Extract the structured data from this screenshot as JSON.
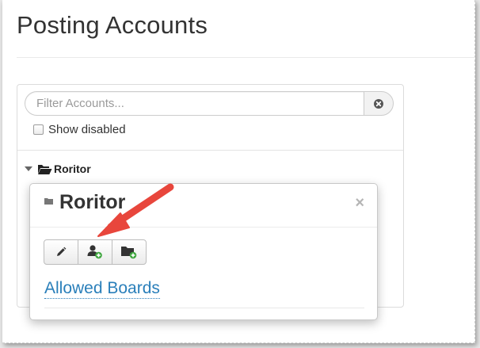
{
  "page": {
    "title": "Posting Accounts"
  },
  "filter": {
    "placeholder": "Filter Accounts...",
    "value": "",
    "clear_icon": "times-circle-icon"
  },
  "show_disabled": {
    "label": "Show disabled",
    "checked": false
  },
  "tree": {
    "items": [
      {
        "label": "Roritor",
        "icon": "folder-open-icon",
        "expanded": true
      }
    ]
  },
  "popover": {
    "title": "Roritor",
    "title_icon": "folder-icon",
    "close_label": "×",
    "buttons": [
      {
        "icon": "pencil-icon",
        "action": "edit"
      },
      {
        "icon": "user-plus-icon",
        "action": "add-account"
      },
      {
        "icon": "folder-plus-icon",
        "action": "add-folder"
      }
    ],
    "link_label": "Allowed Boards"
  },
  "annotation": {
    "arrow_color": "#e8463c",
    "target": "user-plus-icon"
  },
  "colors": {
    "link": "#2a7fba",
    "badge_green": "#3fa63f",
    "arrow": "#e8463c"
  }
}
